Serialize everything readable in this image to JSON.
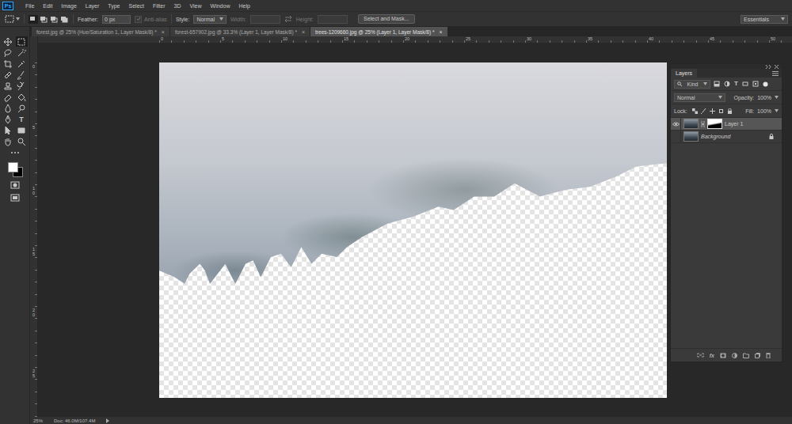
{
  "app": {
    "logo": "Ps"
  },
  "menu": [
    "File",
    "Edit",
    "Image",
    "Layer",
    "Type",
    "Select",
    "Filter",
    "3D",
    "View",
    "Window",
    "Help"
  ],
  "options": {
    "selection_modes": [
      {
        "selected": true
      },
      {
        "selected": false
      },
      {
        "selected": false
      },
      {
        "selected": false
      }
    ],
    "feather": {
      "label": "Feather:",
      "value": "0 px"
    },
    "anti_alias": {
      "label": "Anti-alias",
      "checked": true,
      "disabled": true
    },
    "style": {
      "label": "Style:",
      "value": "Normal"
    },
    "width": {
      "label": "Width:",
      "disabled": true
    },
    "height": {
      "label": "Height:",
      "disabled": true
    },
    "select_and_mask": "Select and Mask...",
    "workspace": "Essentials"
  },
  "tabs": [
    {
      "label": "forest.jpg @ 25% (Hue/Saturation 1, Layer Mask/8) *",
      "close": "×",
      "selected": false
    },
    {
      "label": "forest-657902.jpg @ 33.3% (Layer 1, Layer Mask/8) *",
      "close": "×",
      "selected": false
    },
    {
      "label": "trees-1209660.jpg @ 25% (Layer 1, Layer Mask/8) *",
      "close": "×",
      "selected": true
    }
  ],
  "tools": [
    {
      "kind": "icon",
      "selected": false
    },
    {
      "kind": "icon",
      "selected": true
    },
    {
      "kind": "icon",
      "selected": false
    },
    {
      "kind": "icon",
      "selected": false
    },
    {
      "kind": "icon",
      "selected": false
    },
    {
      "kind": "icon",
      "selected": false
    },
    {
      "kind": "icon",
      "selected": false
    },
    {
      "kind": "icon",
      "selected": false
    },
    {
      "kind": "icon",
      "selected": false
    },
    {
      "kind": "icon",
      "selected": false
    },
    {
      "kind": "icon",
      "selected": false
    },
    {
      "kind": "icon",
      "selected": false
    },
    {
      "kind": "icon",
      "selected": false
    },
    {
      "kind": "icon",
      "selected": false
    },
    {
      "kind": "icon",
      "selected": false
    },
    {
      "kind": "glyph",
      "glyph": "T",
      "selected": false
    },
    {
      "kind": "icon",
      "selected": false
    },
    {
      "kind": "icon",
      "selected": false
    },
    {
      "kind": "icon",
      "selected": false
    },
    {
      "kind": "icon",
      "selected": false
    }
  ],
  "swatches": {
    "foreground": "#ffffff",
    "background": "#000000"
  },
  "ruler": {
    "top": [
      "0",
      "5",
      "10",
      "15",
      "20",
      "25",
      "30",
      "35",
      "40",
      "45",
      "50"
    ],
    "left": [
      "0",
      "5",
      "10",
      "15",
      "20",
      "25"
    ]
  },
  "layers_panel": {
    "title": "Layers",
    "filter": "Kind",
    "type_filter_glyph": "T",
    "blend": "Normal",
    "opacity_label": "Opacity:",
    "opacity": "100%",
    "lock_label": "Lock:",
    "fill_label": "Fill:",
    "fill": "100%",
    "layers": [
      {
        "name": "Layer 1",
        "visible": true,
        "selected": true,
        "has_mask": true,
        "locked": false
      },
      {
        "name": "Background",
        "visible": false,
        "selected": false,
        "has_mask": false,
        "locked": true
      }
    ],
    "footer_fx": "fx"
  },
  "status": {
    "zoom": "25%",
    "doc": "Doc: 46.0M/107.4M"
  }
}
